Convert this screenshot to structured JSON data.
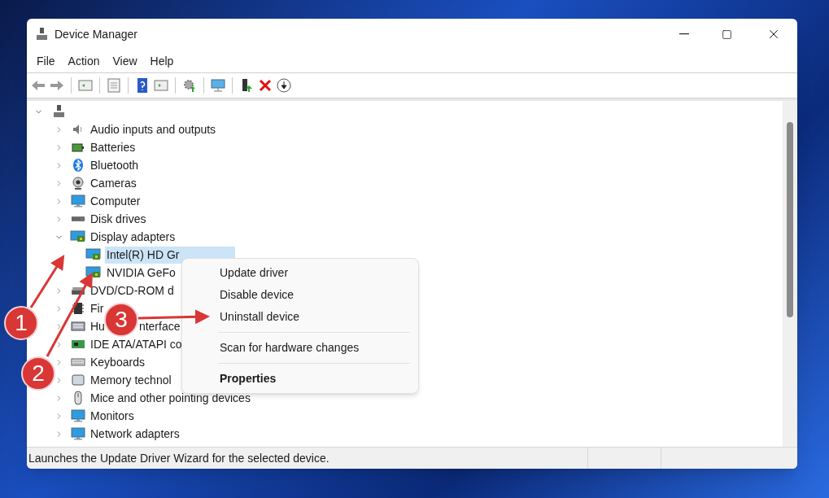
{
  "window": {
    "title": "Device Manager"
  },
  "menu": [
    "File",
    "Action",
    "View",
    "Help"
  ],
  "tree": {
    "expanded": true,
    "children": [
      {
        "label": "Audio inputs and outputs",
        "expanded": false,
        "selected": false
      },
      {
        "label": "Batteries",
        "expanded": false,
        "selected": false
      },
      {
        "label": "Bluetooth",
        "expanded": false,
        "selected": false
      },
      {
        "label": "Cameras",
        "expanded": false,
        "selected": false
      },
      {
        "label": "Computer",
        "expanded": false,
        "selected": false
      },
      {
        "label": "Disk drives",
        "expanded": false,
        "selected": false
      },
      {
        "label": "Display adapters",
        "expanded": true,
        "selected": false,
        "children": [
          {
            "label": "Intel(R) HD Gr",
            "selected": true
          },
          {
            "label": "NVIDIA GeFo",
            "selected": false
          }
        ]
      },
      {
        "label": "DVD/CD-ROM d",
        "expanded": false,
        "selected": false
      },
      {
        "label": "Fir",
        "expanded": false,
        "selected": false
      },
      {
        "label": "Hu",
        "label_after": "nterface",
        "expanded": false,
        "selected": false
      },
      {
        "label": "IDE ATA/ATAPI co",
        "expanded": false,
        "selected": false
      },
      {
        "label": "Keyboards",
        "expanded": false,
        "selected": false
      },
      {
        "label": "Memory technol",
        "expanded": false,
        "selected": false
      },
      {
        "label": "Mice and other pointing devices",
        "expanded": false,
        "selected": false
      },
      {
        "label": "Monitors",
        "expanded": false,
        "selected": false
      },
      {
        "label": "Network adapters",
        "expanded": false,
        "selected": false
      }
    ]
  },
  "context_menu": [
    {
      "kind": "item",
      "label": "Update driver"
    },
    {
      "kind": "item",
      "label": "Disable device"
    },
    {
      "kind": "item",
      "label": "Uninstall device"
    },
    {
      "kind": "separator"
    },
    {
      "kind": "item",
      "label": "Scan for hardware changes"
    },
    {
      "kind": "separator"
    },
    {
      "kind": "default",
      "label": "Properties"
    }
  ],
  "annotations": [
    {
      "label": "1"
    },
    {
      "label": "2"
    },
    {
      "label": "3"
    }
  ],
  "status_bar": {
    "text": "Launches the Update Driver Wizard for the selected device."
  }
}
